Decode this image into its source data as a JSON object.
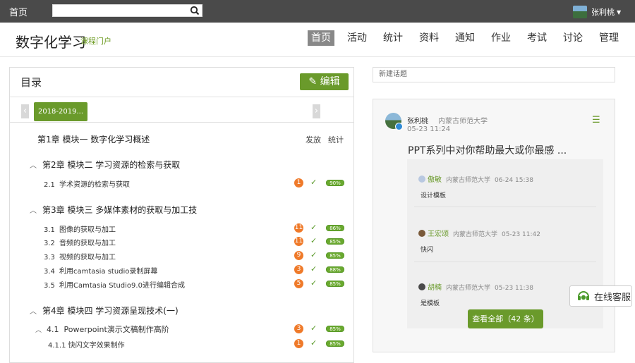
{
  "topbar": {
    "home": "首页",
    "search_placeholder": "",
    "user_name": "张利桃"
  },
  "header": {
    "brand": "数字化学习",
    "brand_sub": "课程门户",
    "nav": [
      "首页",
      "活动",
      "统计",
      "资料",
      "通知",
      "作业",
      "考试",
      "讨论",
      "管理"
    ],
    "active_nav": "首页"
  },
  "catalog": {
    "title": "目录",
    "edit_label": "编辑",
    "term_tab": "2018-2019...",
    "chapter1": "第1章 模块一 数字化学习概述",
    "actions": [
      "发放",
      "统计"
    ],
    "chapters": [
      {
        "title": "第2章 模块二 学习资源的检索与获取",
        "sections": [
          {
            "num": "2.1",
            "title": "学术资源的检索与获取",
            "count": "1",
            "pct": "90%"
          }
        ]
      },
      {
        "title": "第3章 模块三 多媒体素材的获取与加工技",
        "sections": [
          {
            "num": "3.1",
            "title": "图像的获取与加工",
            "count": "11",
            "pct": "86%"
          },
          {
            "num": "3.2",
            "title": "音频的获取与加工",
            "count": "11",
            "pct": "85%"
          },
          {
            "num": "3.3",
            "title": "视频的获取与加工",
            "count": "9",
            "pct": "85%"
          },
          {
            "num": "3.4",
            "title": "利用camtasia studio录制屏幕",
            "count": "3",
            "pct": "88%"
          },
          {
            "num": "3.5",
            "title": "利用Camtasia Studio9.0进行编辑合成",
            "count": "5",
            "pct": "85%"
          }
        ]
      },
      {
        "title": "第4章 模块四 学习资源呈现技术(一)",
        "sections": [
          {
            "num": "4.1",
            "title": "Powerpoint演示文稿制作高阶",
            "count": "3",
            "pct": "85%"
          },
          {
            "num": "4.1.1",
            "title": "快闪文字效果制作",
            "count": "1",
            "pct": "85%"
          }
        ]
      }
    ]
  },
  "discussion": {
    "new_topic": "新建话题",
    "author": "张利桃",
    "school": "内蒙古师范大学",
    "date": "05-23 11:24",
    "title": "PPT系列中对你帮助最大或你最感 ...",
    "replies": [
      {
        "name": "傲敏",
        "school": "内蒙古师范大学",
        "date": "06-24 15:38",
        "text": "设计模板"
      },
      {
        "name": "王宏颂",
        "school": "内蒙古师范大学",
        "date": "05-23 11:42",
        "text": "快闪"
      },
      {
        "name": "胡楠",
        "school": "内蒙古师范大学",
        "date": "05-23 11:38",
        "text": "是模板"
      }
    ],
    "view_all": "查看全部（42 条）"
  },
  "service": {
    "label": "在线客服"
  },
  "icons": [
    "search-icon",
    "chevron-down-icon",
    "pencil-icon",
    "chevron-left-icon",
    "chevron-right-icon",
    "check-icon",
    "menu-icon",
    "headset-icon"
  ],
  "colors": {
    "accent": "#6a9a2b",
    "badge": "#ef7a2a",
    "topbar": "#4a4a4a"
  }
}
